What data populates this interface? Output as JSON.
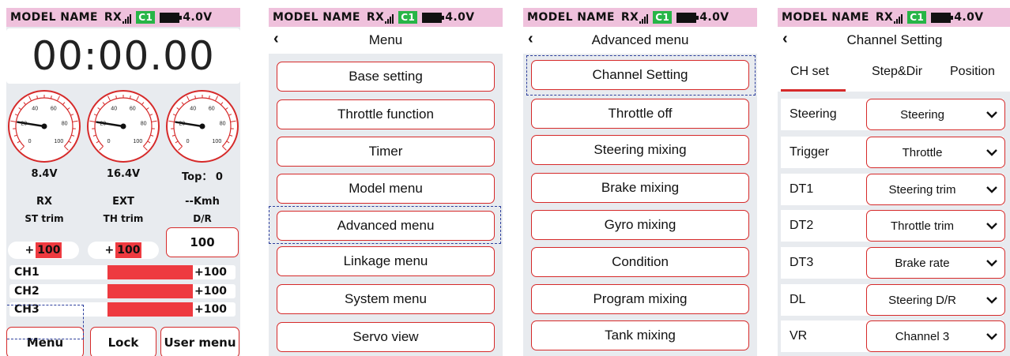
{
  "status": {
    "model_name": "MODEL NAME",
    "rx": "RX",
    "channel": "C1",
    "battery": "4.0V"
  },
  "screen1": {
    "timer": "00:00.00",
    "gauges": [
      {
        "value": 0.2,
        "reading": "8.4V",
        "name": "RX",
        "ticks": [
          "0",
          "20",
          "40",
          "60",
          "80",
          "100"
        ]
      },
      {
        "value": 0.2,
        "reading": "16.4V",
        "name": "EXT",
        "ticks": [
          "0",
          "20",
          "40",
          "60",
          "80",
          "100"
        ]
      },
      {
        "value": 0.2,
        "reading": "Top： 0",
        "name": "--Kmh",
        "ticks": [
          "0",
          "20",
          "40",
          "60",
          "80",
          "100"
        ]
      }
    ],
    "st_trim": {
      "label": "ST trim",
      "sign": "+",
      "value": "100"
    },
    "th_trim": {
      "label": "TH trim",
      "sign": "+",
      "value": "100"
    },
    "dr": {
      "label": "D/R",
      "value": "100"
    },
    "channels": [
      {
        "label": "CH1",
        "value": "+100",
        "level": 1.0
      },
      {
        "label": "CH2",
        "value": "+100",
        "level": 1.0
      },
      {
        "label": "CH3",
        "value": "+100",
        "level": 1.0
      }
    ],
    "buttons": {
      "menu": "Menu",
      "lock": "Lock",
      "user_menu": "User menu"
    }
  },
  "screen2": {
    "title": "Menu",
    "items": [
      "Base setting",
      "Throttle function",
      "Timer",
      "Model menu",
      "Advanced menu",
      "Linkage menu",
      "System menu",
      "Servo view"
    ]
  },
  "screen3": {
    "title": "Advanced menu",
    "items": [
      "Channel Setting",
      "Throttle off",
      "Steering mixing",
      "Brake mixing",
      "Gyro mixing",
      "Condition",
      "Program mixing",
      "Tank mixing"
    ]
  },
  "screen4": {
    "title": "Channel Setting",
    "tabs": [
      "CH set",
      "Step&Dir",
      "Position"
    ],
    "rows": [
      {
        "label": "Steering",
        "value": "Steering"
      },
      {
        "label": "Trigger",
        "value": "Throttle"
      },
      {
        "label": "DT1",
        "value": "Steering trim"
      },
      {
        "label": "DT2",
        "value": "Throttle trim"
      },
      {
        "label": "DT3",
        "value": "Brake rate"
      },
      {
        "label": "DL",
        "value": "Steering D/R"
      },
      {
        "label": "VR",
        "value": "Channel 3"
      }
    ]
  },
  "icons": {
    "back": "back-arrow-icon",
    "signal": "signal-bars-icon",
    "battery": "battery-icon",
    "dropdown": "chevron-down-icon"
  },
  "colors": {
    "status_bar": "#efc1dc",
    "accent_red": "#d62a2a",
    "bar_red": "#ee3a40",
    "channel_badge": "#27b547",
    "selection": "#2c3e9c",
    "screen_bg": "#e8ebef"
  }
}
